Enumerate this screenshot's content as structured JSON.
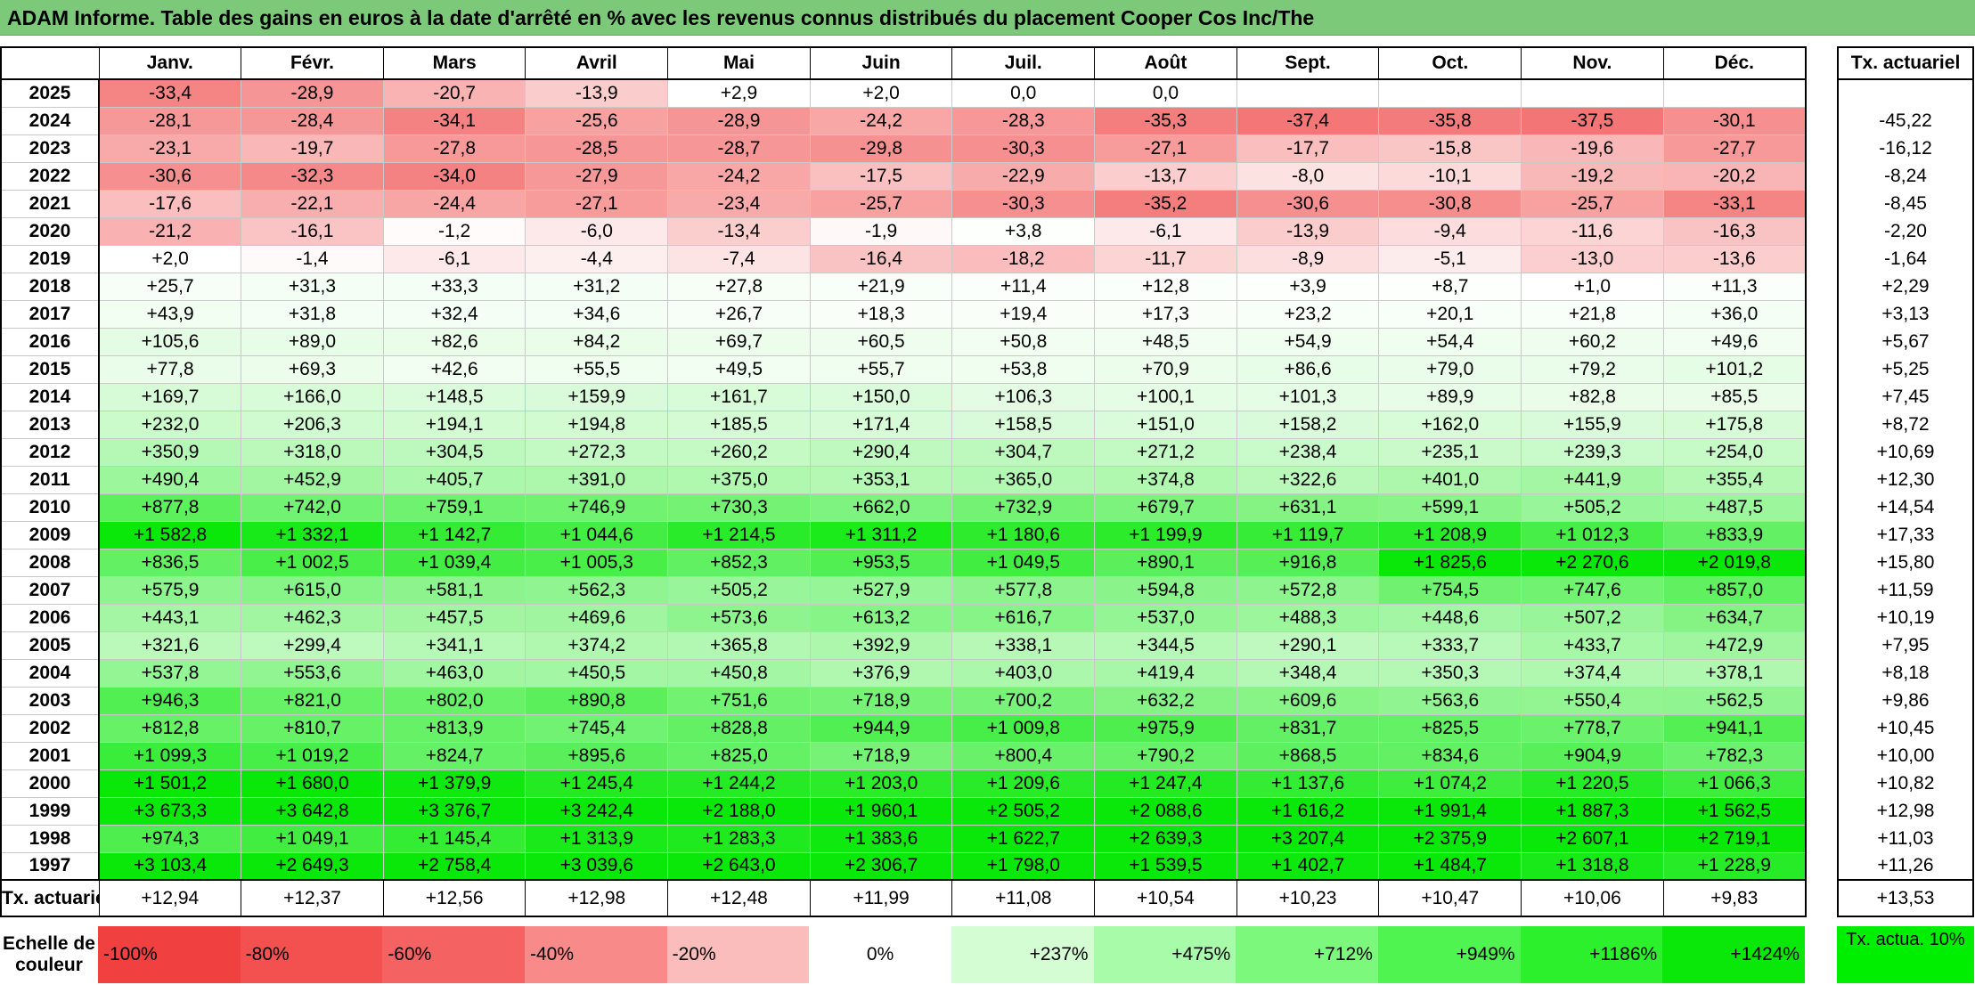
{
  "title": "ADAM Informe. Table des gains en euros à la date d'arrêté en % avec les revenus connus distribués du placement Cooper Cos Inc/The",
  "months": [
    "Janv.",
    "Févr.",
    "Mars",
    "Avril",
    "Mai",
    "Juin",
    "Juil.",
    "Août",
    "Sept.",
    "Oct.",
    "Nov.",
    "Déc."
  ],
  "tx_header": "Tx. actuariel",
  "rows": [
    {
      "year": "2025",
      "cells": [
        "-33,4",
        "-28,9",
        "-20,7",
        "-13,9",
        "+2,9",
        "+2,0",
        "0,0",
        "0,0",
        "",
        "",
        "",
        ""
      ],
      "tx": ""
    },
    {
      "year": "2024",
      "cells": [
        "-28,1",
        "-28,4",
        "-34,1",
        "-25,6",
        "-28,9",
        "-24,2",
        "-28,3",
        "-35,3",
        "-37,4",
        "-35,8",
        "-37,5",
        "-30,1"
      ],
      "tx": "-45,22"
    },
    {
      "year": "2023",
      "cells": [
        "-23,1",
        "-19,7",
        "-27,8",
        "-28,5",
        "-28,7",
        "-29,8",
        "-30,3",
        "-27,1",
        "-17,7",
        "-15,8",
        "-19,6",
        "-27,7"
      ],
      "tx": "-16,12"
    },
    {
      "year": "2022",
      "cells": [
        "-30,6",
        "-32,3",
        "-34,0",
        "-27,9",
        "-24,2",
        "-17,5",
        "-22,9",
        "-13,7",
        "-8,0",
        "-10,1",
        "-19,2",
        "-20,2"
      ],
      "tx": "-8,24"
    },
    {
      "year": "2021",
      "cells": [
        "-17,6",
        "-22,1",
        "-24,4",
        "-27,1",
        "-23,4",
        "-25,7",
        "-30,3",
        "-35,2",
        "-30,6",
        "-30,8",
        "-25,7",
        "-33,1"
      ],
      "tx": "-8,45"
    },
    {
      "year": "2020",
      "cells": [
        "-21,2",
        "-16,1",
        "-1,2",
        "-6,0",
        "-13,4",
        "-1,9",
        "+3,8",
        "-6,1",
        "-13,9",
        "-9,4",
        "-11,6",
        "-16,3"
      ],
      "tx": "-2,20"
    },
    {
      "year": "2019",
      "cells": [
        "+2,0",
        "-1,4",
        "-6,1",
        "-4,4",
        "-7,4",
        "-16,4",
        "-18,2",
        "-11,7",
        "-8,9",
        "-5,1",
        "-13,0",
        "-13,6"
      ],
      "tx": "-1,64"
    },
    {
      "year": "2018",
      "cells": [
        "+25,7",
        "+31,3",
        "+33,3",
        "+31,2",
        "+27,8",
        "+21,9",
        "+11,4",
        "+12,8",
        "+3,9",
        "+8,7",
        "+1,0",
        "+11,3"
      ],
      "tx": "+2,29"
    },
    {
      "year": "2017",
      "cells": [
        "+43,9",
        "+31,8",
        "+32,4",
        "+34,6",
        "+26,7",
        "+18,3",
        "+19,4",
        "+17,3",
        "+23,2",
        "+20,1",
        "+21,8",
        "+36,0"
      ],
      "tx": "+3,13"
    },
    {
      "year": "2016",
      "cells": [
        "+105,6",
        "+89,0",
        "+82,6",
        "+84,2",
        "+69,7",
        "+60,5",
        "+50,8",
        "+48,5",
        "+54,9",
        "+54,4",
        "+60,2",
        "+49,6"
      ],
      "tx": "+5,67"
    },
    {
      "year": "2015",
      "cells": [
        "+77,8",
        "+69,3",
        "+42,6",
        "+55,5",
        "+49,5",
        "+55,7",
        "+53,8",
        "+70,9",
        "+86,6",
        "+79,0",
        "+79,2",
        "+101,2"
      ],
      "tx": "+5,25"
    },
    {
      "year": "2014",
      "cells": [
        "+169,7",
        "+166,0",
        "+148,5",
        "+159,9",
        "+161,7",
        "+150,0",
        "+106,3",
        "+100,1",
        "+101,3",
        "+89,9",
        "+82,8",
        "+85,5"
      ],
      "tx": "+7,45"
    },
    {
      "year": "2013",
      "cells": [
        "+232,0",
        "+206,3",
        "+194,1",
        "+194,8",
        "+185,5",
        "+171,4",
        "+158,5",
        "+151,0",
        "+158,2",
        "+162,0",
        "+155,9",
        "+175,8"
      ],
      "tx": "+8,72"
    },
    {
      "year": "2012",
      "cells": [
        "+350,9",
        "+318,0",
        "+304,5",
        "+272,3",
        "+260,2",
        "+290,4",
        "+304,7",
        "+271,2",
        "+238,4",
        "+235,1",
        "+239,3",
        "+254,0"
      ],
      "tx": "+10,69"
    },
    {
      "year": "2011",
      "cells": [
        "+490,4",
        "+452,9",
        "+405,7",
        "+391,0",
        "+375,0",
        "+353,1",
        "+365,0",
        "+374,8",
        "+322,6",
        "+401,0",
        "+441,9",
        "+355,4"
      ],
      "tx": "+12,30"
    },
    {
      "year": "2010",
      "cells": [
        "+877,8",
        "+742,0",
        "+759,1",
        "+746,9",
        "+730,3",
        "+662,0",
        "+732,9",
        "+679,7",
        "+631,1",
        "+599,1",
        "+505,2",
        "+487,5"
      ],
      "tx": "+14,54"
    },
    {
      "year": "2009",
      "cells": [
        "+1 582,8",
        "+1 332,1",
        "+1 142,7",
        "+1 044,6",
        "+1 214,5",
        "+1 311,2",
        "+1 180,6",
        "+1 199,9",
        "+1 119,7",
        "+1 208,9",
        "+1 012,3",
        "+833,9"
      ],
      "tx": "+17,33"
    },
    {
      "year": "2008",
      "cells": [
        "+836,5",
        "+1 002,5",
        "+1 039,4",
        "+1 005,3",
        "+852,3",
        "+953,5",
        "+1 049,5",
        "+890,1",
        "+916,8",
        "+1 825,6",
        "+2 270,6",
        "+2 019,8"
      ],
      "tx": "+15,80"
    },
    {
      "year": "2007",
      "cells": [
        "+575,9",
        "+615,0",
        "+581,1",
        "+562,3",
        "+505,2",
        "+527,9",
        "+577,8",
        "+594,8",
        "+572,8",
        "+754,5",
        "+747,6",
        "+857,0"
      ],
      "tx": "+11,59"
    },
    {
      "year": "2006",
      "cells": [
        "+443,1",
        "+462,3",
        "+457,5",
        "+469,6",
        "+573,6",
        "+613,2",
        "+616,7",
        "+537,0",
        "+488,3",
        "+448,6",
        "+507,2",
        "+634,7"
      ],
      "tx": "+10,19"
    },
    {
      "year": "2005",
      "cells": [
        "+321,6",
        "+299,4",
        "+341,1",
        "+374,2",
        "+365,8",
        "+392,9",
        "+338,1",
        "+344,5",
        "+290,1",
        "+333,7",
        "+433,7",
        "+472,9"
      ],
      "tx": "+7,95"
    },
    {
      "year": "2004",
      "cells": [
        "+537,8",
        "+553,6",
        "+463,0",
        "+450,5",
        "+450,8",
        "+376,9",
        "+403,0",
        "+419,4",
        "+348,4",
        "+350,3",
        "+374,4",
        "+378,1"
      ],
      "tx": "+8,18"
    },
    {
      "year": "2003",
      "cells": [
        "+946,3",
        "+821,0",
        "+802,0",
        "+890,8",
        "+751,6",
        "+718,9",
        "+700,2",
        "+632,2",
        "+609,6",
        "+563,6",
        "+550,4",
        "+562,5"
      ],
      "tx": "+9,86"
    },
    {
      "year": "2002",
      "cells": [
        "+812,8",
        "+810,7",
        "+813,9",
        "+745,4",
        "+828,8",
        "+944,9",
        "+1 009,8",
        "+975,9",
        "+831,7",
        "+825,5",
        "+778,7",
        "+941,1"
      ],
      "tx": "+10,45"
    },
    {
      "year": "2001",
      "cells": [
        "+1 099,3",
        "+1 019,2",
        "+824,7",
        "+895,6",
        "+825,0",
        "+718,9",
        "+800,4",
        "+790,2",
        "+868,5",
        "+834,6",
        "+904,9",
        "+782,3"
      ],
      "tx": "+10,00"
    },
    {
      "year": "2000",
      "cells": [
        "+1 501,2",
        "+1 680,0",
        "+1 379,9",
        "+1 245,4",
        "+1 244,2",
        "+1 203,0",
        "+1 209,6",
        "+1 247,4",
        "+1 137,6",
        "+1 074,2",
        "+1 220,5",
        "+1 066,3"
      ],
      "tx": "+10,82"
    },
    {
      "year": "1999",
      "cells": [
        "+3 673,3",
        "+3 642,8",
        "+3 376,7",
        "+3 242,4",
        "+2 188,0",
        "+1 960,1",
        "+2 505,2",
        "+2 088,6",
        "+1 616,2",
        "+1 991,4",
        "+1 887,3",
        "+1 562,5"
      ],
      "tx": "+12,98"
    },
    {
      "year": "1998",
      "cells": [
        "+974,3",
        "+1 049,1",
        "+1 145,4",
        "+1 313,9",
        "+1 283,3",
        "+1 383,6",
        "+1 622,7",
        "+2 639,3",
        "+3 207,4",
        "+2 375,9",
        "+2 607,1",
        "+2 719,1"
      ],
      "tx": "+11,03"
    },
    {
      "year": "1997",
      "cells": [
        "+3 103,4",
        "+2 649,3",
        "+2 758,4",
        "+3 039,6",
        "+2 643,0",
        "+2 306,7",
        "+1 798,0",
        "+1 539,5",
        "+1 402,7",
        "+1 484,7",
        "+1 318,8",
        "+1 228,9"
      ],
      "tx": "+11,26"
    }
  ],
  "footer": {
    "label": "Tx. actuariel",
    "cells": [
      "+12,94",
      "+12,37",
      "+12,56",
      "+12,98",
      "+12,48",
      "+11,99",
      "+11,08",
      "+10,54",
      "+10,23",
      "+10,47",
      "+10,06",
      "+9,83"
    ],
    "tx": "+13,53"
  },
  "scale": {
    "label": "Echelle de couleur",
    "steps": [
      {
        "label": "-100%",
        "color": "#f04040"
      },
      {
        "label": "-80%",
        "color": "#f35050"
      },
      {
        "label": "-60%",
        "color": "#f56262"
      },
      {
        "label": "-40%",
        "color": "#f88a8a"
      },
      {
        "label": "-20%",
        "color": "#fbbcbc"
      },
      {
        "label": "0%",
        "color": "#ffffff"
      },
      {
        "label": "+237%",
        "color": "#d4fdd4"
      },
      {
        "label": "+475%",
        "color": "#a8fba8"
      },
      {
        "label": "+712%",
        "color": "#7cf87c"
      },
      {
        "label": "+949%",
        "color": "#50f450"
      },
      {
        "label": "+1186%",
        "color": "#2cf02c"
      },
      {
        "label": "+1424%",
        "color": "#0ae80a"
      }
    ],
    "tx_label": "Tx. actua. 10%",
    "tx_color": "#00ee00"
  }
}
